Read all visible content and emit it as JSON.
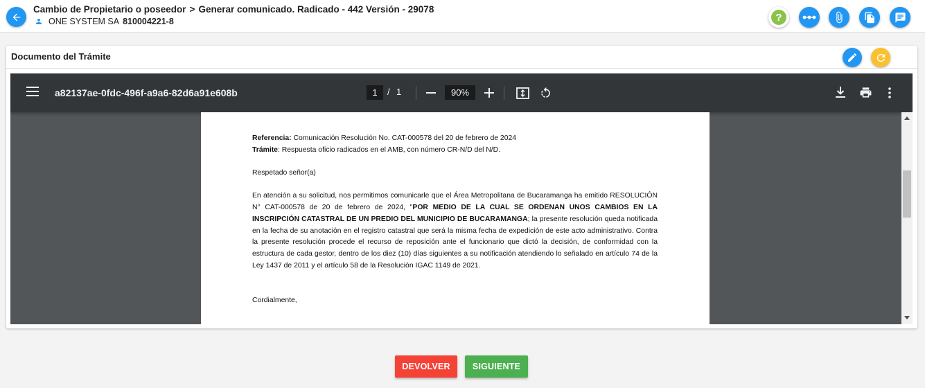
{
  "header": {
    "breadcrumb_1": "Cambio de Propietario o poseedor",
    "breadcrumb_sep": ">",
    "breadcrumb_2": "Generar comunicado. Radicado - 442 Versión - 29078",
    "company": "ONE SYSTEM SA",
    "nit": "810004221-8",
    "help_label": "?",
    "icons": [
      "arrow-left-icon",
      "help-icon",
      "more-horizontal-icon",
      "attachment-icon",
      "copy-document-icon",
      "message-icon"
    ]
  },
  "card": {
    "title": "Documento del Trámite",
    "icons": [
      "edit-icon",
      "refresh-icon"
    ]
  },
  "viewer": {
    "file_name": "a82137ae-0fdc-496f-a9a6-82d6a91e608b",
    "current_page": "1",
    "page_sep": "/",
    "total_pages": "1",
    "zoom": "90%",
    "icons": [
      "menu-icon",
      "zoom-out-icon",
      "zoom-in-icon",
      "fit-page-icon",
      "rotate-icon",
      "download-icon",
      "print-icon",
      "more-vertical-icon"
    ]
  },
  "document": {
    "ref_label": "Referencia:",
    "ref_text": " Comunicación Resolución No. CAT-000578 del 20 de febrero de 2024",
    "tramite_label": "Trámite",
    "tramite_text": ": Respuesta oficio radicados en el AMB, con número CR-N/D del N/D.",
    "greeting": "Respetado señor(a)",
    "body_part1": "En atención a su solicitud, nos permitimos comunicarle que el Área Metropolitana de Bucaramanga ha emitido RESOLUCIÓN N° CAT-000578 de 20 de febrero de 2024, \"",
    "body_bold": "POR MEDIO DE LA CUAL SE ORDENAN UNOS CAMBIOS EN LA INSCRIPCIÓN CATASTRAL DE UN PREDIO DEL MUNICIPIO DE BUCARAMANGA",
    "body_part2": "; la presente resolución queda notificada en la fecha de su anotación en el registro catastral que será la misma fecha de expedición de este acto administrativo. Contra la presente resolución procede el recurso de reposición ante el funcionario que dictó la decisión, de conformidad con la estructura de cada gestor, dentro de los diez (10) días siguientes a su notificación atendiendo lo señalado en artículo 74 de la Ley 1437 de 2011 y el artículo 58 de la Resolución IGAC 1149 de 2021.",
    "closing": "Cordialmente,"
  },
  "footer": {
    "devolver_label": "DEVOLVER",
    "siguiente_label": "SIGUIENTE"
  },
  "colors": {
    "primary": "#2196f3",
    "help": "#8bc34a",
    "refresh": "#fbc02d",
    "devolver": "#f44336",
    "siguiente": "#4caf50",
    "toolbar": "#323639",
    "viewer_bg": "#525659"
  }
}
